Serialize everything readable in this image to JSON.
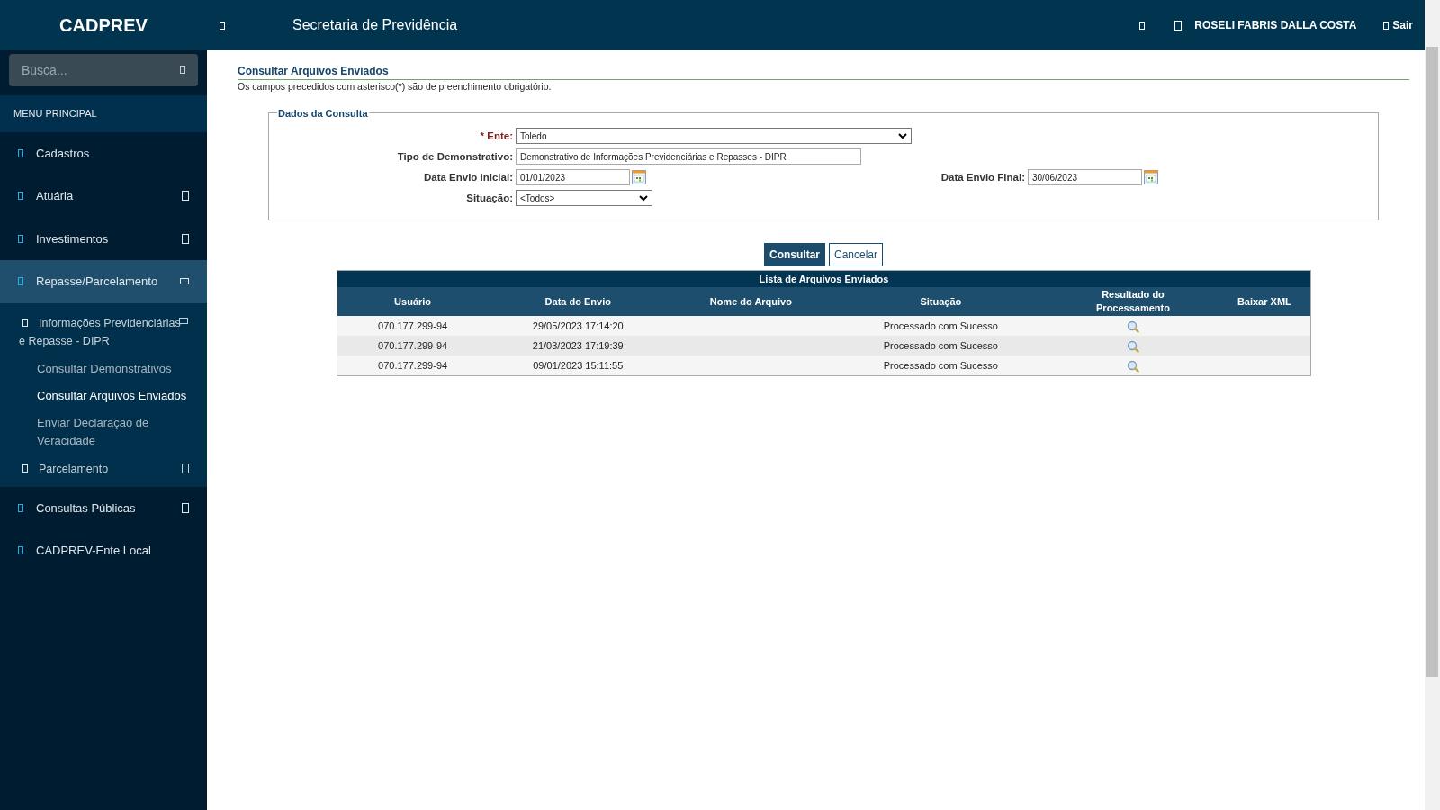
{
  "header": {
    "brand": "CADPREV",
    "title": "Secretaria de Previdência",
    "user_name": "ROSELI FABRIS DALLA COSTA",
    "logout": "Sair"
  },
  "sidebar": {
    "search": {
      "placeholder": "Busca..."
    },
    "menu_heading": "MENU PRINCIPAL",
    "items": [
      {
        "label": "Cadastros",
        "has_submenu": false,
        "selected": false
      },
      {
        "label": "Atuária",
        "has_submenu": true,
        "expanded": false,
        "selected": false
      },
      {
        "label": "Investimentos",
        "has_submenu": true,
        "expanded": false,
        "selected": false
      },
      {
        "label": "Repasse/Parcelamento",
        "has_submenu": true,
        "expanded": true,
        "selected": true,
        "children": [
          {
            "label": "Informações Previdenciárias e Repasse - DIPR",
            "has_submenu": true,
            "expanded": true,
            "selected": false,
            "children": [
              {
                "label": "Consultar Demonstrativos",
                "selected": false
              },
              {
                "label": "Consultar Arquivos Enviados",
                "selected": true
              },
              {
                "label": "Enviar Declaração de Veracidade",
                "selected": false
              }
            ]
          },
          {
            "label": "Parcelamento",
            "has_submenu": true,
            "expanded": false,
            "selected": false
          }
        ]
      },
      {
        "label": "Consultas Públicas",
        "has_submenu": true,
        "expanded": false,
        "selected": false
      },
      {
        "label": "CADPREV-Ente Local",
        "has_submenu": false,
        "selected": false
      }
    ]
  },
  "page": {
    "title": "Consultar Arquivos Enviados",
    "note": "Os campos precedidos com asterisco(*) são de preenchimento obrigatório."
  },
  "form": {
    "legend": "Dados da Consulta",
    "rows": [
      [
        {
          "kind": "select",
          "label": "* Ente:",
          "required": true,
          "value": "Toledo"
        }
      ],
      [
        {
          "kind": "text",
          "label": "Tipo de Demonstrativo:",
          "required": false,
          "value": "Demonstrativo de Informações Previdenciárias e Repasses - DIPR"
        }
      ],
      [
        {
          "kind": "date",
          "label": "Data Envio Inicial:",
          "required": false,
          "value": "01/01/2023"
        },
        {
          "kind": "date",
          "label": "Data Envio Final:",
          "required": false,
          "value": "30/06/2023"
        }
      ],
      [
        {
          "kind": "select-small",
          "label": "Situação:",
          "required": false,
          "value": "<Todos>"
        }
      ]
    ]
  },
  "buttons": [
    {
      "label": "Consultar",
      "kind": "primary"
    },
    {
      "label": "Cancelar",
      "kind": "secondary"
    }
  ],
  "table": {
    "title": "Lista de Arquivos Enviados",
    "columns": [
      "Usuário",
      "Data do Envio",
      "Nome do Arquivo",
      "Situação",
      "Resultado do Processamento",
      "Baixar XML"
    ],
    "rows": [
      {
        "usuario": "070.177.299-94",
        "data_envio": "29/05/2023 17:14:20",
        "situacao": "Processado com Sucesso"
      },
      {
        "usuario": "070.177.299-94",
        "data_envio": "21/03/2023 17:19:39",
        "situacao": "Processado com Sucesso"
      },
      {
        "usuario": "070.177.299-94",
        "data_envio": "09/01/2023 15:11:55",
        "situacao": "Processado com Sucesso"
      }
    ]
  }
}
